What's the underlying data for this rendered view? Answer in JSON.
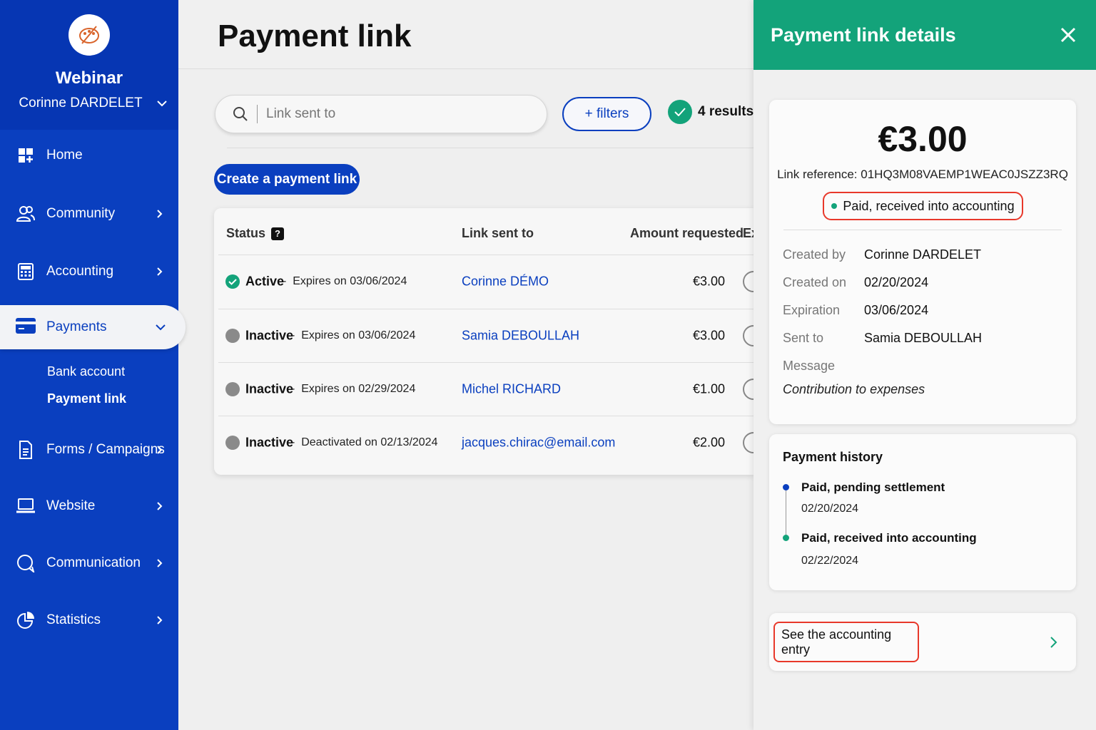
{
  "sidebar": {
    "org_name": "Webinar",
    "user_name": "Corinne DARDELET",
    "items": [
      {
        "label": "Home",
        "icon": "dashboard-icon"
      },
      {
        "label": "Community",
        "icon": "people-icon"
      },
      {
        "label": "Accounting",
        "icon": "calculator-icon"
      },
      {
        "label": "Payments",
        "icon": "credit-card-icon"
      },
      {
        "label": "Forms / Campaigns",
        "icon": "document-icon"
      },
      {
        "label": "Website",
        "icon": "laptop-icon"
      },
      {
        "label": "Communication",
        "icon": "chat-icon"
      },
      {
        "label": "Statistics",
        "icon": "pie-chart-icon"
      }
    ],
    "sub_items": [
      "Bank account",
      "Payment link"
    ],
    "active_item": "Payments",
    "active_sub_item": "Payment link"
  },
  "main": {
    "title": "Payment link",
    "search": {
      "placeholder": "Link sent to",
      "value": ""
    },
    "filters_label": "+ filters",
    "results_label": "4 results",
    "create_label": "Create a payment link",
    "table": {
      "headers": [
        "Status",
        "Link sent to",
        "Amount requested",
        "Ex"
      ],
      "rows": [
        {
          "status": "Active",
          "detail": "Expires on 03/06/2024",
          "sent_to": "Corinne DÉMO",
          "amount": "€3.00"
        },
        {
          "status": "Inactive",
          "detail": "Expires on 03/06/2024",
          "sent_to": "Samia DEBOULLAH",
          "amount": "€3.00"
        },
        {
          "status": "Inactive",
          "detail": "Expires on 02/29/2024",
          "sent_to": "Michel RICHARD",
          "amount": "€1.00"
        },
        {
          "status": "Inactive",
          "detail": "Deactivated on 02/13/2024",
          "sent_to": "jacques.chirac@email.com",
          "amount": "€2.00"
        }
      ]
    }
  },
  "panel": {
    "title": "Payment link details",
    "amount": "€3.00",
    "reference": "Link reference: 01HQ3M08VAEMP1WEAC0JSZZ3RQ",
    "status_badge": "Paid, received into accounting",
    "fields": [
      {
        "label": "Created by",
        "value": "Corinne DARDELET"
      },
      {
        "label": "Created on",
        "value": "02/20/2024"
      },
      {
        "label": "Expiration",
        "value": "03/06/2024"
      },
      {
        "label": "Sent to",
        "value": "Samia DEBOULLAH"
      }
    ],
    "message_label": "Message",
    "message": "Contribution to expenses",
    "history_title": "Payment history",
    "history": [
      {
        "title": "Paid, pending settlement",
        "date": "02/20/2024"
      },
      {
        "title": "Paid, received into accounting",
        "date": "02/22/2024"
      }
    ],
    "accounting_link": "See the accounting entry"
  },
  "colors": {
    "primary": "#0a3fbf",
    "success": "#13a37a",
    "highlight": "#e8382a"
  }
}
